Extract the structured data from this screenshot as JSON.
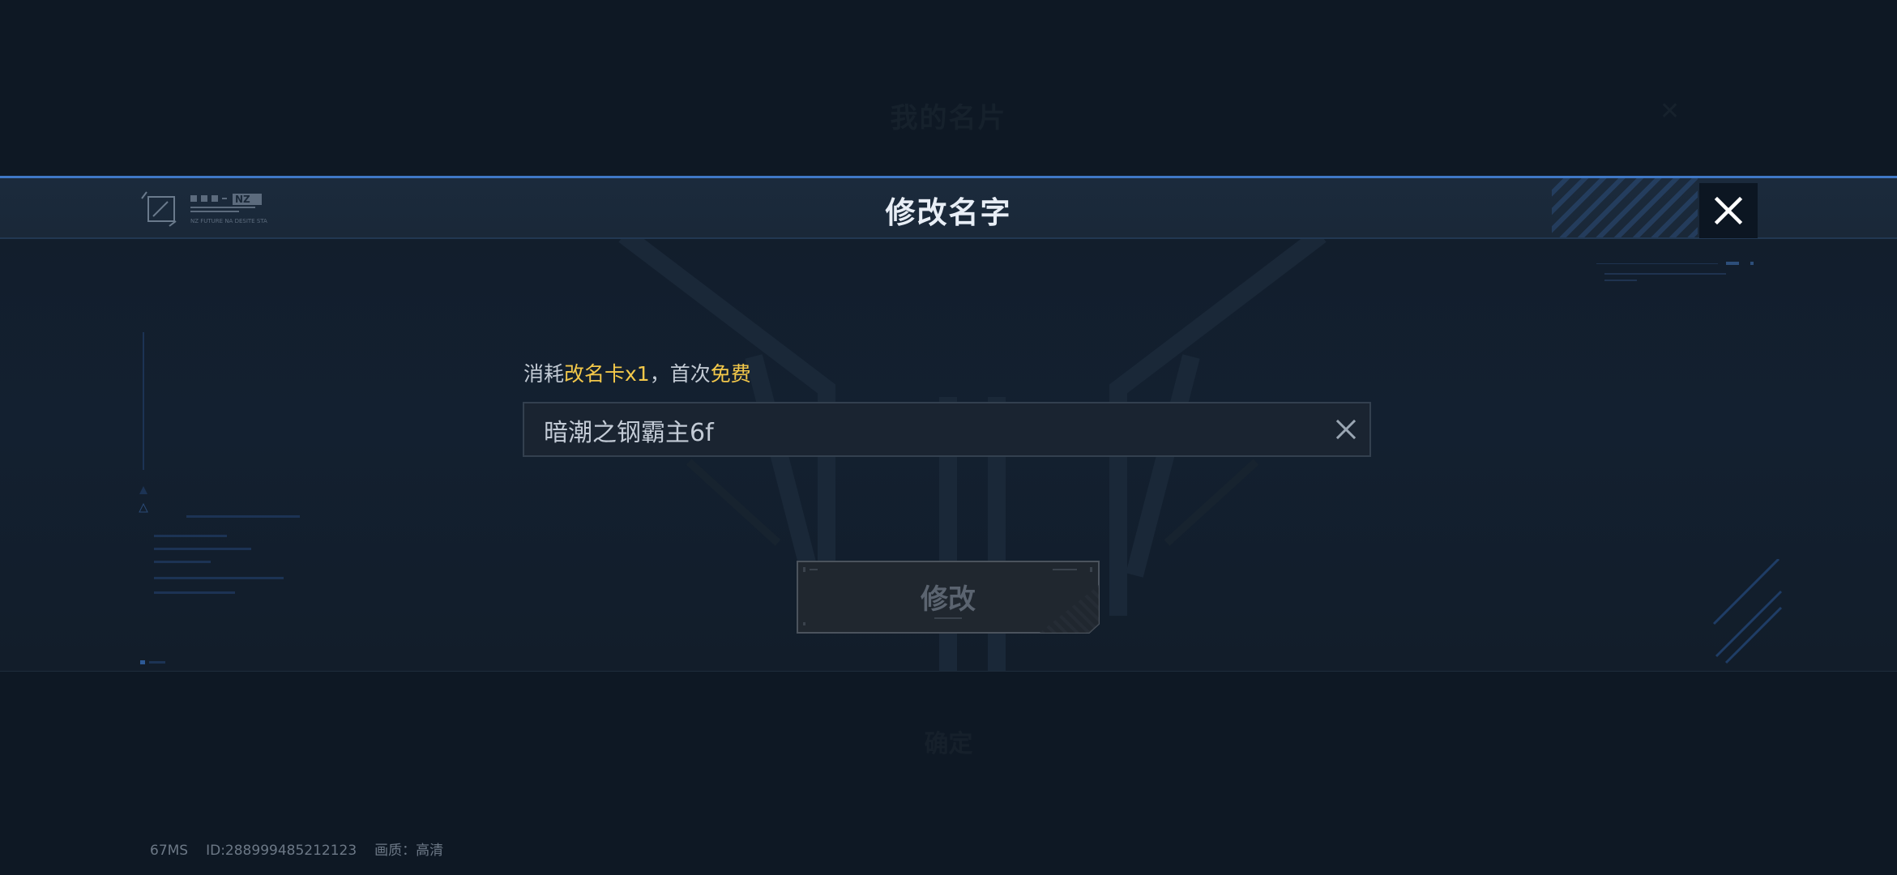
{
  "background": {
    "title": "我的名片",
    "confirm_label": "确定"
  },
  "dialog": {
    "title": "修改名字",
    "brand_tag": "NZ",
    "brand_subtext": "NZ FUTURE NA DESITE STA",
    "cost": {
      "prefix": "消耗",
      "item": "改名卡x1",
      "separator": "，首次",
      "free": "免费"
    },
    "name_input": {
      "value": "暗潮之钢霸主6f",
      "placeholder": ""
    },
    "modify_button_label": "修改"
  },
  "status": {
    "latency": "67MS",
    "id": "ID:288999485212123",
    "quality": "画质：高清"
  },
  "colors": {
    "accent_blue": "#3f78c6",
    "highlight_yellow": "#f3c84a",
    "title_text": "#e8eef6"
  },
  "icons": {
    "close": "close-icon",
    "clear": "clear-icon",
    "brand": "edit-square-icon"
  }
}
